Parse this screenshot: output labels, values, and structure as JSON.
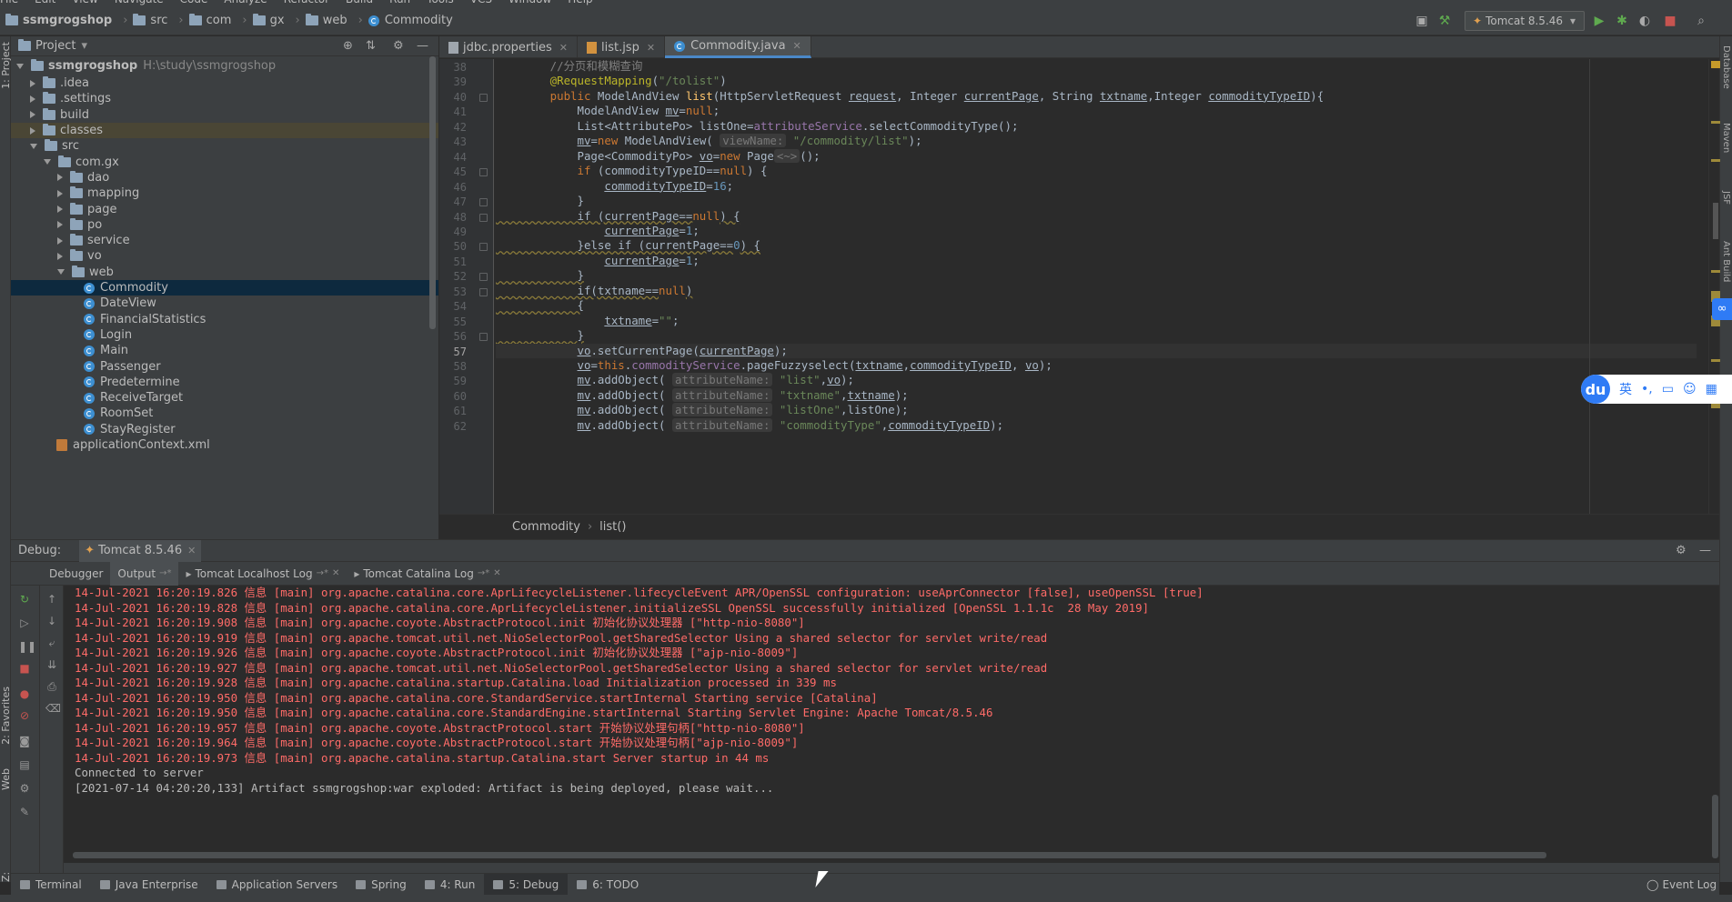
{
  "menu": [
    "File",
    "Edit",
    "View",
    "Navigate",
    "Code",
    "Analyze",
    "Refactor",
    "Build",
    "Run",
    "Tools",
    "VCS",
    "Window",
    "Help"
  ],
  "nav": {
    "project": "ssmgrogshop",
    "crumbs": [
      "src",
      "com",
      "gx",
      "web"
    ],
    "current": "Commodity"
  },
  "run_config": "Tomcat 8.5.46",
  "left_strip": {
    "project": "1: Project",
    "favorites": "2: Favorites",
    "web": "Web",
    "structure": "Z: Structure"
  },
  "right_strip": [
    "Database",
    "Maven",
    "JSF",
    "Ant Build"
  ],
  "project_panel": {
    "title": "Project",
    "root_name": "ssmgrogshop",
    "root_path": "H:\\study\\ssmgrogshop",
    "items": [
      {
        "name": ".idea",
        "type": "folder",
        "depth": 1,
        "arrow": "r"
      },
      {
        "name": ".settings",
        "type": "folder",
        "depth": 1,
        "arrow": "r"
      },
      {
        "name": "build",
        "type": "folder",
        "depth": 1,
        "arrow": "r"
      },
      {
        "name": "classes",
        "type": "folder",
        "depth": 1,
        "arrow": "r",
        "hl": true
      },
      {
        "name": "src",
        "type": "folder",
        "depth": 1,
        "arrow": "d"
      },
      {
        "name": "com.gx",
        "type": "folder",
        "depth": 2,
        "arrow": "d"
      },
      {
        "name": "dao",
        "type": "folder",
        "depth": 3,
        "arrow": "r"
      },
      {
        "name": "mapping",
        "type": "folder",
        "depth": 3,
        "arrow": "r"
      },
      {
        "name": "page",
        "type": "folder",
        "depth": 3,
        "arrow": "r"
      },
      {
        "name": "po",
        "type": "folder",
        "depth": 3,
        "arrow": "r"
      },
      {
        "name": "service",
        "type": "folder",
        "depth": 3,
        "arrow": "r"
      },
      {
        "name": "vo",
        "type": "folder",
        "depth": 3,
        "arrow": "r"
      },
      {
        "name": "web",
        "type": "folder",
        "depth": 3,
        "arrow": "d"
      },
      {
        "name": "Commodity",
        "type": "class",
        "depth": 4,
        "arrow": "none",
        "selected": true
      },
      {
        "name": "DateView",
        "type": "class",
        "depth": 4,
        "arrow": "none"
      },
      {
        "name": "FinancialStatistics",
        "type": "class",
        "depth": 4,
        "arrow": "none"
      },
      {
        "name": "Login",
        "type": "class",
        "depth": 4,
        "arrow": "none"
      },
      {
        "name": "Main",
        "type": "class",
        "depth": 4,
        "arrow": "none"
      },
      {
        "name": "Passenger",
        "type": "class",
        "depth": 4,
        "arrow": "none"
      },
      {
        "name": "Predetermine",
        "type": "class",
        "depth": 4,
        "arrow": "none"
      },
      {
        "name": "ReceiveTarget",
        "type": "class",
        "depth": 4,
        "arrow": "none"
      },
      {
        "name": "RoomSet",
        "type": "class",
        "depth": 4,
        "arrow": "none"
      },
      {
        "name": "StayRegister",
        "type": "class",
        "depth": 4,
        "arrow": "none"
      },
      {
        "name": "applicationContext.xml",
        "type": "xml",
        "depth": 2,
        "arrow": "none"
      }
    ]
  },
  "editor_tabs": [
    {
      "label": "jdbc.properties",
      "icon": "file"
    },
    {
      "label": "list.jsp",
      "icon": "jsp"
    },
    {
      "label": "Commodity.java",
      "icon": "class",
      "active": true
    }
  ],
  "code": {
    "first_line": 38,
    "current_line": 57,
    "lines": [
      [
        [
          "cmt",
          "        //分页和模糊查询"
        ]
      ],
      [
        [
          "ann",
          "        @RequestMapping"
        ],
        [
          "",
          "("
        ],
        [
          "str",
          "\"/tolist\""
        ],
        [
          "",
          ")"
        ]
      ],
      [
        [
          "kw",
          "        public "
        ],
        [
          "",
          "ModelAndView "
        ],
        [
          "mth",
          "list"
        ],
        [
          "",
          "(HttpServletRequest "
        ],
        [
          "ul",
          "request"
        ],
        [
          "",
          ", Integer "
        ],
        [
          "ul",
          "currentPage"
        ],
        [
          "",
          ", String "
        ],
        [
          "ul",
          "txtname"
        ],
        [
          "",
          ",Integer "
        ],
        [
          "ul",
          "commodityTypeID"
        ],
        [
          "",
          "){"
        ]
      ],
      [
        [
          "",
          "            ModelAndView "
        ],
        [
          "ul",
          "mv"
        ],
        [
          "",
          "="
        ],
        [
          "kw",
          "null"
        ],
        [
          "",
          ";"
        ]
      ],
      [
        [
          "",
          "            List<AttributePo> listOne="
        ],
        [
          "fld",
          "attributeService"
        ],
        [
          "",
          ".selectCommodityType();"
        ]
      ],
      [
        [
          "",
          "            "
        ],
        [
          "ul",
          "mv"
        ],
        [
          "",
          "="
        ],
        [
          "kw",
          "new "
        ],
        [
          "",
          "ModelAndView( "
        ],
        [
          "hint",
          "viewName:"
        ],
        [
          "str",
          " \"/commodity/list\""
        ],
        [
          "",
          ");"
        ]
      ],
      [
        [
          "",
          "            Page<CommodityPo> "
        ],
        [
          "ul",
          "vo"
        ],
        [
          "",
          "="
        ],
        [
          "kw",
          "new "
        ],
        [
          "",
          "Page"
        ],
        [
          "hint",
          "<~>"
        ],
        [
          "",
          "();"
        ]
      ],
      [
        [
          "kw",
          "            if "
        ],
        [
          "",
          "(commodityTypeID=="
        ],
        [
          "kw",
          "null"
        ],
        [
          "",
          ") {"
        ]
      ],
      [
        [
          "",
          "                "
        ],
        [
          "ul",
          "commodityTypeID"
        ],
        [
          "",
          "="
        ],
        [
          "num",
          "16"
        ],
        [
          "",
          ";"
        ]
      ],
      [
        [
          "",
          "            }"
        ]
      ],
      [
        [
          "warn",
          "            if (currentPage=="
        ],
        [
          "kw",
          "null"
        ],
        [
          "warn",
          ") {"
        ]
      ],
      [
        [
          "",
          "                "
        ],
        [
          "ul",
          "currentPage"
        ],
        [
          "",
          "="
        ],
        [
          "num",
          "1"
        ],
        [
          "",
          ";"
        ]
      ],
      [
        [
          "warn",
          "            }else if (currentPage=="
        ],
        [
          "num",
          "0"
        ],
        [
          "warn",
          ") {"
        ]
      ],
      [
        [
          "",
          "                "
        ],
        [
          "ul",
          "currentPage"
        ],
        [
          "",
          "="
        ],
        [
          "num",
          "1"
        ],
        [
          "",
          ";"
        ]
      ],
      [
        [
          "warn",
          "            }"
        ]
      ],
      [
        [
          "warn",
          "            if(txtname=="
        ],
        [
          "kw",
          "null"
        ],
        [
          "warn",
          ")"
        ]
      ],
      [
        [
          "warn",
          "            {"
        ]
      ],
      [
        [
          "",
          "                "
        ],
        [
          "ul",
          "txtname"
        ],
        [
          "",
          "="
        ],
        [
          "str",
          "\"\""
        ],
        [
          "",
          ";"
        ]
      ],
      [
        [
          "warn",
          "            }"
        ]
      ],
      [
        [
          "",
          "            "
        ],
        [
          "ul",
          "vo"
        ],
        [
          "",
          ".setCurrentPage("
        ],
        [
          "ul",
          "currentPage"
        ],
        [
          "",
          ");"
        ]
      ],
      [
        [
          "",
          "            "
        ],
        [
          "ul",
          "vo"
        ],
        [
          "",
          "="
        ],
        [
          "kw",
          "this"
        ],
        [
          "",
          "."
        ],
        [
          "fld",
          "commodityService"
        ],
        [
          "",
          ".pageFuzzyselect("
        ],
        [
          "ul",
          "txtname"
        ],
        [
          "",
          ","
        ],
        [
          "ul",
          "commodityTypeID"
        ],
        [
          "",
          ", "
        ],
        [
          "ul",
          "vo"
        ],
        [
          "",
          ");"
        ]
      ],
      [
        [
          "",
          "            "
        ],
        [
          "ul",
          "mv"
        ],
        [
          "",
          ".addObject( "
        ],
        [
          "hint",
          "attributeName:"
        ],
        [
          "str",
          " \"list\""
        ],
        [
          "",
          ","
        ],
        [
          "ul",
          "vo"
        ],
        [
          "",
          ");"
        ]
      ],
      [
        [
          "",
          "            "
        ],
        [
          "ul",
          "mv"
        ],
        [
          "",
          ".addObject( "
        ],
        [
          "hint",
          "attributeName:"
        ],
        [
          "str",
          " \"txtname\""
        ],
        [
          "",
          ","
        ],
        [
          "ul",
          "txtname"
        ],
        [
          "",
          ");"
        ]
      ],
      [
        [
          "",
          "            "
        ],
        [
          "ul",
          "mv"
        ],
        [
          "",
          ".addObject( "
        ],
        [
          "hint",
          "attributeName:"
        ],
        [
          "str",
          " \"listOne\""
        ],
        [
          "",
          ",listOne);"
        ]
      ],
      [
        [
          "",
          "            "
        ],
        [
          "ul",
          "mv"
        ],
        [
          "",
          ".addObject( "
        ],
        [
          "hint",
          "attributeName:"
        ],
        [
          "str",
          " \"commodityType\""
        ],
        [
          "",
          ","
        ],
        [
          "ul",
          "commodityTypeID"
        ],
        [
          "",
          ");"
        ]
      ]
    ]
  },
  "editor_breadcrumb": [
    "Commodity",
    "list()"
  ],
  "debug": {
    "label": "Debug:",
    "session": "Tomcat 8.5.46",
    "tabs": [
      "Debugger",
      "Output",
      "Tomcat Localhost Log",
      "Tomcat Catalina Log"
    ],
    "active_tab": "Output",
    "log_red": [
      "14-Jul-2021 16:20:19.826 信息 [main] org.apache.catalina.core.AprLifecycleListener.lifecycleEvent APR/OpenSSL configuration: useAprConnector [false], useOpenSSL [true]",
      "14-Jul-2021 16:20:19.828 信息 [main] org.apache.catalina.core.AprLifecycleListener.initializeSSL OpenSSL successfully initialized [OpenSSL 1.1.1c  28 May 2019]",
      "14-Jul-2021 16:20:19.908 信息 [main] org.apache.coyote.AbstractProtocol.init 初始化协议处理器 [\"http-nio-8080\"]",
      "14-Jul-2021 16:20:19.919 信息 [main] org.apache.tomcat.util.net.NioSelectorPool.getSharedSelector Using a shared selector for servlet write/read",
      "14-Jul-2021 16:20:19.926 信息 [main] org.apache.coyote.AbstractProtocol.init 初始化协议处理器 [\"ajp-nio-8009\"]",
      "14-Jul-2021 16:20:19.927 信息 [main] org.apache.tomcat.util.net.NioSelectorPool.getSharedSelector Using a shared selector for servlet write/read",
      "14-Jul-2021 16:20:19.928 信息 [main] org.apache.catalina.startup.Catalina.load Initialization processed in 339 ms",
      "14-Jul-2021 16:20:19.950 信息 [main] org.apache.catalina.core.StandardService.startInternal Starting service [Catalina]",
      "14-Jul-2021 16:20:19.950 信息 [main] org.apache.catalina.core.StandardEngine.startInternal Starting Servlet Engine: Apache Tomcat/8.5.46",
      "14-Jul-2021 16:20:19.957 信息 [main] org.apache.coyote.AbstractProtocol.start 开始协议处理句柄[\"http-nio-8080\"]",
      "14-Jul-2021 16:20:19.964 信息 [main] org.apache.coyote.AbstractProtocol.start 开始协议处理句柄[\"ajp-nio-8009\"]",
      "14-Jul-2021 16:20:19.973 信息 [main] org.apache.catalina.startup.Catalina.start Server startup in 44 ms"
    ],
    "log_white": [
      "Connected to server",
      "[2021-07-14 04:20:20,133] Artifact ssmgrogshop:war exploded: Artifact is being deployed, please wait..."
    ]
  },
  "bottom_tabs": [
    {
      "label": "Terminal"
    },
    {
      "label": "Java Enterprise"
    },
    {
      "label": "Application Servers"
    },
    {
      "label": "Spring"
    },
    {
      "label": "4: Run"
    },
    {
      "label": "5: Debug",
      "active": true
    },
    {
      "label": "6: TODO"
    }
  ],
  "event_log": "Event Log",
  "ime": {
    "logo": "du",
    "lang": "英",
    "punct": "•,"
  }
}
